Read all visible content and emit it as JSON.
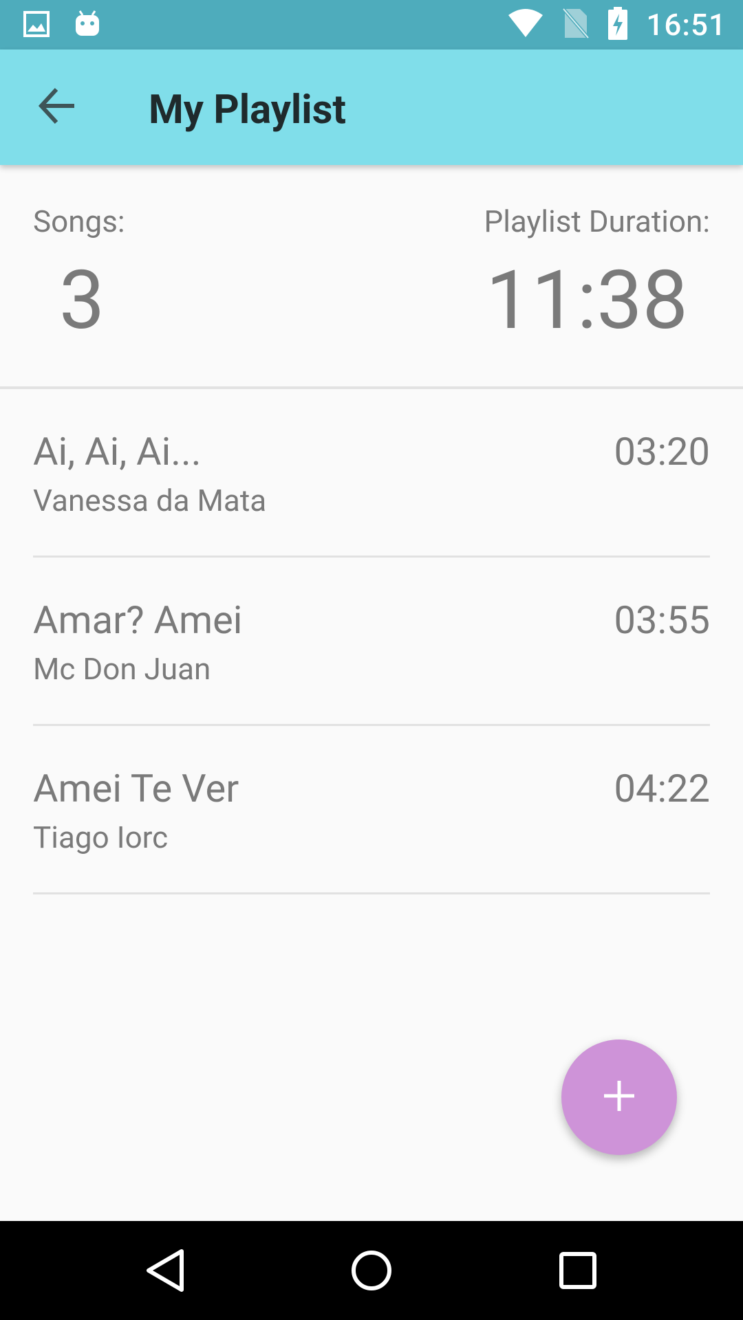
{
  "status_bar": {
    "time": "16:51",
    "left_icons": [
      "image-icon",
      "android-icon"
    ],
    "right_icons": [
      "wifi-icon",
      "no-sim-icon",
      "battery-charging-icon"
    ],
    "background": "#4eacbc"
  },
  "app_bar": {
    "title": "My Playlist",
    "back_icon": "arrow-back-icon",
    "background": "#80deea"
  },
  "summary": {
    "songs_label": "Songs:",
    "songs_count": "3",
    "duration_label": "Playlist Duration:",
    "duration_value": "11:38"
  },
  "songs": [
    {
      "title": "Ai, Ai, Ai...",
      "artist": "Vanessa da Mata",
      "duration": "03:20"
    },
    {
      "title": "Amar? Amei",
      "artist": "Mc Don Juan",
      "duration": "03:55"
    },
    {
      "title": "Amei Te Ver",
      "artist": "Tiago Iorc",
      "duration": "04:22"
    }
  ],
  "fab": {
    "icon": "plus-icon",
    "color": "#ce93d8"
  },
  "nav_bar": {
    "buttons": [
      "back-triangle-icon",
      "home-circle-icon",
      "recents-square-icon"
    ]
  }
}
